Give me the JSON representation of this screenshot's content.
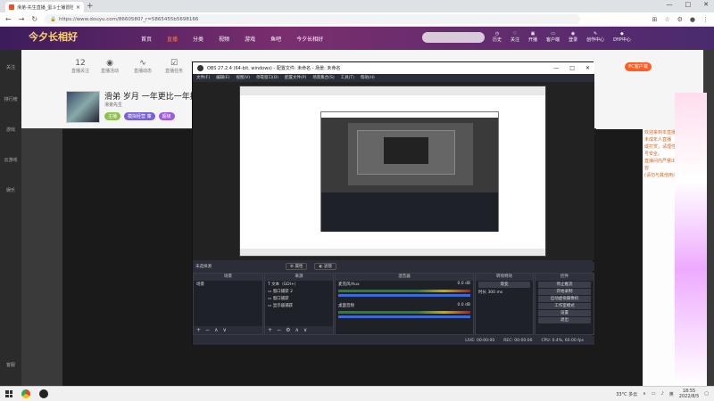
{
  "browser": {
    "tab_title": "滑弟-先生直播_蛋斗士播冒险...",
    "url": "https://www.douyu.com/8660580?_r=5865455b5698166",
    "window_buttons": [
      "—",
      "□",
      "✕"
    ]
  },
  "douyu": {
    "logo": "今夕长相好",
    "nav": [
      "首页",
      "直播",
      "分类",
      "视频",
      "游戏",
      "鱼吧",
      "今夕长相好"
    ],
    "active_nav": "直播",
    "icons": [
      "历史",
      "关注",
      "开播",
      "客户端",
      "登录",
      "创作中心",
      "DYP中心"
    ],
    "sidebar": [
      "关注",
      "排行榜",
      "游戏",
      "云游戏",
      "娱乐",
      "客服"
    ],
    "stats": [
      {
        "value": "12",
        "label": "直播关注"
      },
      {
        "value": "",
        "label": "直播活动"
      },
      {
        "value": "",
        "label": "直播动态"
      },
      {
        "value": "",
        "label": "直播任务"
      }
    ],
    "room": {
      "title": "滑弟 岁月 一年更比一年搭",
      "streamer": "滑弟先生",
      "tags": [
        "主播",
        "模拟经营 策",
        "超级"
      ]
    },
    "fc_button": "PC客户端",
    "chat_lines": [
      "欢迎来到本直播间，斗鱼严禁未成年人直播",
      "或打赏，请理性消费，注意账号安全。",
      "直播间内严禁出现违法违规内容",
      "(请勿与其他用户交流)"
    ]
  },
  "obs": {
    "title": "OBS 27.2.4 (64-bit, windows) - 配置文件: 未命名 - 场景: 未命名",
    "menu": [
      "文件(F)",
      "编辑(E)",
      "视图(V)",
      "停靠窗口(D)",
      "配置文件(P)",
      "场景集合(S)",
      "工具(T)",
      "帮助(H)"
    ],
    "source_bar": {
      "label": "未选择源",
      "props": "属性",
      "filters": "滤镜"
    },
    "docks": {
      "scenes": {
        "title": "场景",
        "items": [
          "场景"
        ]
      },
      "sources": {
        "title": "来源",
        "items": [
          "文本（GDI+）",
          "窗口捕获 2",
          "窗口捕获",
          "显示器捕获"
        ]
      },
      "mixer": {
        "title": "混音器",
        "channels": [
          {
            "name": "麦克风/Aux",
            "db": "0.0 dB"
          },
          {
            "name": "桌面音频",
            "db": "0.0 dB"
          }
        ]
      },
      "transitions": {
        "title": "转场特效",
        "type": "渐变",
        "duration_label": "时长",
        "duration": "300 ms"
      },
      "controls": {
        "title": "控件",
        "buttons": [
          "停止推流",
          "开始录制",
          "启动虚拟摄像机",
          "工作室模式",
          "设置",
          "退出"
        ]
      }
    },
    "status": {
      "live": "LIVE: 00:00:00",
      "rec": "REC: 00:00:00",
      "cpu": "CPU: 0.4%, 60.00 fps"
    }
  },
  "taskbar": {
    "weather": "33°C 多云",
    "time": "18:55",
    "date": "2022/8/5",
    "lang": "英"
  }
}
